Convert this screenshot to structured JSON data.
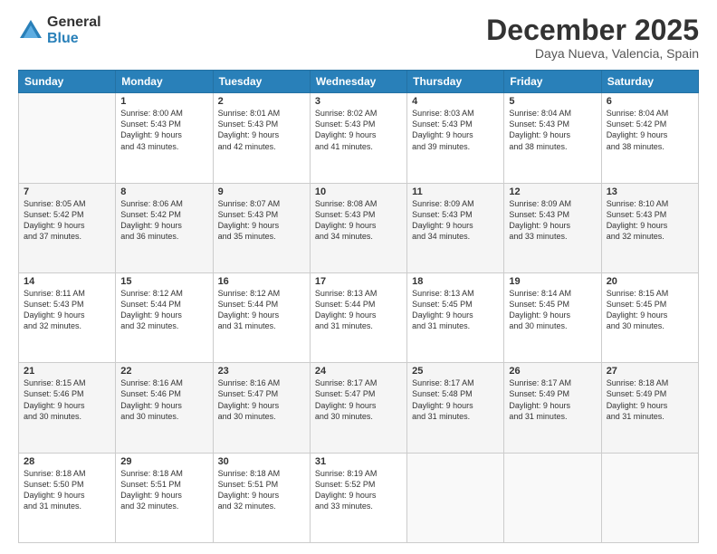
{
  "logo": {
    "general": "General",
    "blue": "Blue"
  },
  "header": {
    "month": "December 2025",
    "location": "Daya Nueva, Valencia, Spain"
  },
  "weekdays": [
    "Sunday",
    "Monday",
    "Tuesday",
    "Wednesday",
    "Thursday",
    "Friday",
    "Saturday"
  ],
  "weeks": [
    [
      {
        "day": "",
        "sunrise": "",
        "sunset": "",
        "daylight": ""
      },
      {
        "day": "1",
        "sunrise": "Sunrise: 8:00 AM",
        "sunset": "Sunset: 5:43 PM",
        "daylight": "Daylight: 9 hours and 43 minutes."
      },
      {
        "day": "2",
        "sunrise": "Sunrise: 8:01 AM",
        "sunset": "Sunset: 5:43 PM",
        "daylight": "Daylight: 9 hours and 42 minutes."
      },
      {
        "day": "3",
        "sunrise": "Sunrise: 8:02 AM",
        "sunset": "Sunset: 5:43 PM",
        "daylight": "Daylight: 9 hours and 41 minutes."
      },
      {
        "day": "4",
        "sunrise": "Sunrise: 8:03 AM",
        "sunset": "Sunset: 5:43 PM",
        "daylight": "Daylight: 9 hours and 39 minutes."
      },
      {
        "day": "5",
        "sunrise": "Sunrise: 8:04 AM",
        "sunset": "Sunset: 5:43 PM",
        "daylight": "Daylight: 9 hours and 38 minutes."
      },
      {
        "day": "6",
        "sunrise": "Sunrise: 8:04 AM",
        "sunset": "Sunset: 5:42 PM",
        "daylight": "Daylight: 9 hours and 38 minutes."
      }
    ],
    [
      {
        "day": "7",
        "sunrise": "Sunrise: 8:05 AM",
        "sunset": "Sunset: 5:42 PM",
        "daylight": "Daylight: 9 hours and 37 minutes."
      },
      {
        "day": "8",
        "sunrise": "Sunrise: 8:06 AM",
        "sunset": "Sunset: 5:42 PM",
        "daylight": "Daylight: 9 hours and 36 minutes."
      },
      {
        "day": "9",
        "sunrise": "Sunrise: 8:07 AM",
        "sunset": "Sunset: 5:43 PM",
        "daylight": "Daylight: 9 hours and 35 minutes."
      },
      {
        "day": "10",
        "sunrise": "Sunrise: 8:08 AM",
        "sunset": "Sunset: 5:43 PM",
        "daylight": "Daylight: 9 hours and 34 minutes."
      },
      {
        "day": "11",
        "sunrise": "Sunrise: 8:09 AM",
        "sunset": "Sunset: 5:43 PM",
        "daylight": "Daylight: 9 hours and 34 minutes."
      },
      {
        "day": "12",
        "sunrise": "Sunrise: 8:09 AM",
        "sunset": "Sunset: 5:43 PM",
        "daylight": "Daylight: 9 hours and 33 minutes."
      },
      {
        "day": "13",
        "sunrise": "Sunrise: 8:10 AM",
        "sunset": "Sunset: 5:43 PM",
        "daylight": "Daylight: 9 hours and 32 minutes."
      }
    ],
    [
      {
        "day": "14",
        "sunrise": "Sunrise: 8:11 AM",
        "sunset": "Sunset: 5:43 PM",
        "daylight": "Daylight: 9 hours and 32 minutes."
      },
      {
        "day": "15",
        "sunrise": "Sunrise: 8:12 AM",
        "sunset": "Sunset: 5:44 PM",
        "daylight": "Daylight: 9 hours and 32 minutes."
      },
      {
        "day": "16",
        "sunrise": "Sunrise: 8:12 AM",
        "sunset": "Sunset: 5:44 PM",
        "daylight": "Daylight: 9 hours and 31 minutes."
      },
      {
        "day": "17",
        "sunrise": "Sunrise: 8:13 AM",
        "sunset": "Sunset: 5:44 PM",
        "daylight": "Daylight: 9 hours and 31 minutes."
      },
      {
        "day": "18",
        "sunrise": "Sunrise: 8:13 AM",
        "sunset": "Sunset: 5:45 PM",
        "daylight": "Daylight: 9 hours and 31 minutes."
      },
      {
        "day": "19",
        "sunrise": "Sunrise: 8:14 AM",
        "sunset": "Sunset: 5:45 PM",
        "daylight": "Daylight: 9 hours and 30 minutes."
      },
      {
        "day": "20",
        "sunrise": "Sunrise: 8:15 AM",
        "sunset": "Sunset: 5:45 PM",
        "daylight": "Daylight: 9 hours and 30 minutes."
      }
    ],
    [
      {
        "day": "21",
        "sunrise": "Sunrise: 8:15 AM",
        "sunset": "Sunset: 5:46 PM",
        "daylight": "Daylight: 9 hours and 30 minutes."
      },
      {
        "day": "22",
        "sunrise": "Sunrise: 8:16 AM",
        "sunset": "Sunset: 5:46 PM",
        "daylight": "Daylight: 9 hours and 30 minutes."
      },
      {
        "day": "23",
        "sunrise": "Sunrise: 8:16 AM",
        "sunset": "Sunset: 5:47 PM",
        "daylight": "Daylight: 9 hours and 30 minutes."
      },
      {
        "day": "24",
        "sunrise": "Sunrise: 8:17 AM",
        "sunset": "Sunset: 5:47 PM",
        "daylight": "Daylight: 9 hours and 30 minutes."
      },
      {
        "day": "25",
        "sunrise": "Sunrise: 8:17 AM",
        "sunset": "Sunset: 5:48 PM",
        "daylight": "Daylight: 9 hours and 31 minutes."
      },
      {
        "day": "26",
        "sunrise": "Sunrise: 8:17 AM",
        "sunset": "Sunset: 5:49 PM",
        "daylight": "Daylight: 9 hours and 31 minutes."
      },
      {
        "day": "27",
        "sunrise": "Sunrise: 8:18 AM",
        "sunset": "Sunset: 5:49 PM",
        "daylight": "Daylight: 9 hours and 31 minutes."
      }
    ],
    [
      {
        "day": "28",
        "sunrise": "Sunrise: 8:18 AM",
        "sunset": "Sunset: 5:50 PM",
        "daylight": "Daylight: 9 hours and 31 minutes."
      },
      {
        "day": "29",
        "sunrise": "Sunrise: 8:18 AM",
        "sunset": "Sunset: 5:51 PM",
        "daylight": "Daylight: 9 hours and 32 minutes."
      },
      {
        "day": "30",
        "sunrise": "Sunrise: 8:18 AM",
        "sunset": "Sunset: 5:51 PM",
        "daylight": "Daylight: 9 hours and 32 minutes."
      },
      {
        "day": "31",
        "sunrise": "Sunrise: 8:19 AM",
        "sunset": "Sunset: 5:52 PM",
        "daylight": "Daylight: 9 hours and 33 minutes."
      },
      {
        "day": "",
        "sunrise": "",
        "sunset": "",
        "daylight": ""
      },
      {
        "day": "",
        "sunrise": "",
        "sunset": "",
        "daylight": ""
      },
      {
        "day": "",
        "sunrise": "",
        "sunset": "",
        "daylight": ""
      }
    ]
  ]
}
